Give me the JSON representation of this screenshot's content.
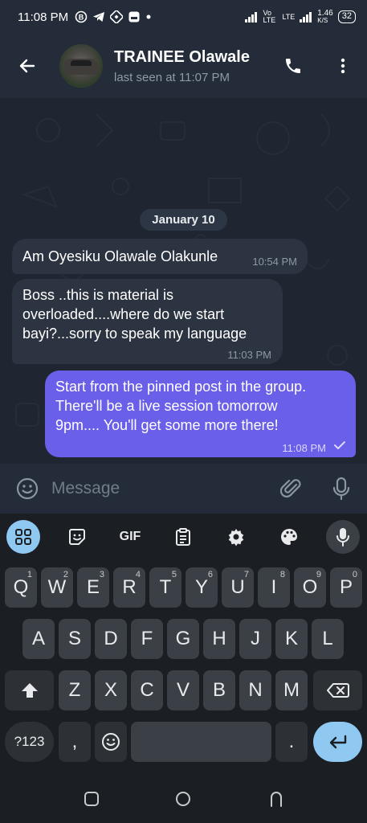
{
  "status_bar": {
    "time": "11:08 PM",
    "network_labels": [
      "Vo LTE",
      "LTE"
    ],
    "speed": "1.46",
    "speed_unit": "K/S",
    "battery": "32"
  },
  "header": {
    "contact_name": "TRAINEE Olawale",
    "last_seen": "last seen at 11:07 PM",
    "icons": [
      "back-arrow-icon",
      "phone-icon",
      "more-vertical-icon"
    ]
  },
  "chat": {
    "date_label": "January 10",
    "messages": [
      {
        "direction": "in",
        "text": "Am Oyesiku Olawale Olakunle",
        "time": "10:54 PM"
      },
      {
        "direction": "in",
        "lines": [
          "Boss ..this is material is",
          "overloaded....where do we start",
          "bayi?...sorry to speak my language"
        ],
        "time": "11:03 PM"
      },
      {
        "direction": "out",
        "lines": [
          "Start from the pinned post in the group.",
          "There'll be a live session tomorrow",
          "9pm.... You'll get some more there!"
        ],
        "time": "11:08 PM",
        "status": "sent"
      }
    ],
    "colors": {
      "outgoing_bubble": "#6a5fe8",
      "incoming_bubble": "#2b3440"
    }
  },
  "input_bar": {
    "placeholder": "Message",
    "icons": [
      "emoji-icon",
      "attach-icon",
      "mic-icon"
    ]
  },
  "keyboard": {
    "toolbar": [
      "apps-grid-icon",
      "sticker-icon",
      "GIF",
      "clipboard-icon",
      "settings-icon",
      "palette-icon",
      "mic-icon"
    ],
    "gif_label": "GIF",
    "row1": [
      {
        "k": "Q",
        "h": "1"
      },
      {
        "k": "W",
        "h": "2"
      },
      {
        "k": "E",
        "h": "3"
      },
      {
        "k": "R",
        "h": "4"
      },
      {
        "k": "T",
        "h": "5"
      },
      {
        "k": "Y",
        "h": "6"
      },
      {
        "k": "U",
        "h": "7"
      },
      {
        "k": "I",
        "h": "8"
      },
      {
        "k": "O",
        "h": "9"
      },
      {
        "k": "P",
        "h": "0"
      }
    ],
    "row2": [
      "A",
      "S",
      "D",
      "F",
      "G",
      "H",
      "J",
      "K",
      "L"
    ],
    "row3": [
      "Z",
      "X",
      "C",
      "V",
      "B",
      "N",
      "M"
    ],
    "row4": {
      "symbols": "?123",
      "comma": ",",
      "period": "."
    },
    "accent": "#8fc9f2"
  },
  "nav": {
    "icons": [
      "recents-icon",
      "home-icon",
      "back-icon"
    ]
  }
}
